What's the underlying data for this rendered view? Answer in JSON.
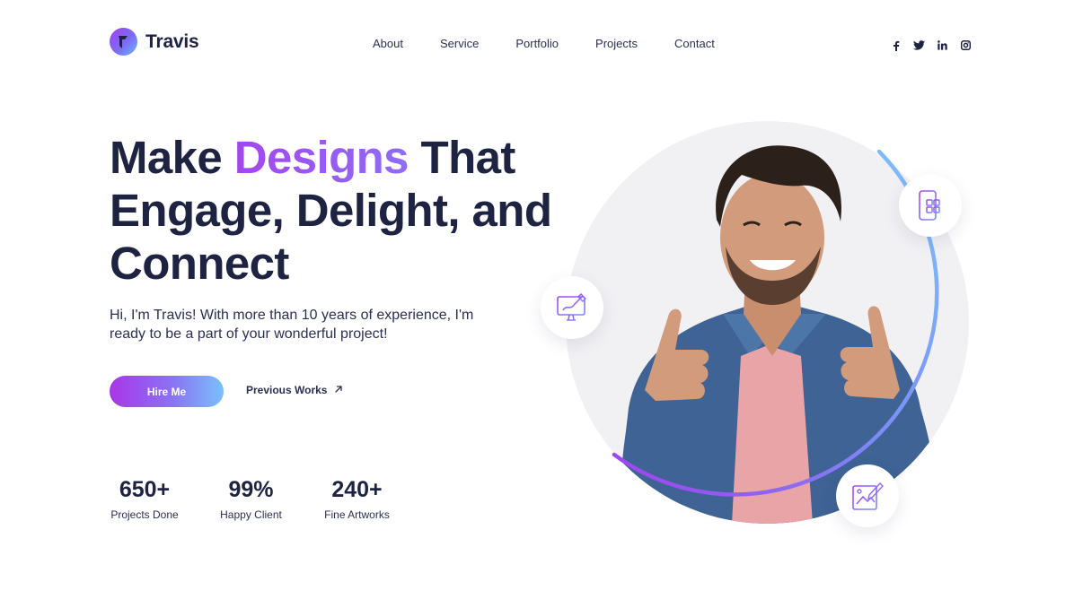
{
  "brand": {
    "name": "Travis",
    "logo_icon": "logo-mark",
    "gradient": [
      "#a23ff0",
      "#6fb6f9"
    ]
  },
  "nav": {
    "items": [
      {
        "label": "About"
      },
      {
        "label": "Service"
      },
      {
        "label": "Portfolio"
      },
      {
        "label": "Projects"
      },
      {
        "label": "Contact"
      }
    ]
  },
  "social": {
    "icons": [
      "facebook-icon",
      "twitter-icon",
      "linkedin-icon",
      "instagram-icon"
    ]
  },
  "hero": {
    "headline": {
      "part1": "Make ",
      "accent": "Designs",
      "part2": " That Engage, Delight, and Connect"
    },
    "intro": "Hi, I'm Travis! With more than 10 years of experience, I'm ready to be a part of your wonderful project!",
    "primary_button": "Hire Me",
    "secondary_link": "Previous Works",
    "secondary_icon": "arrow-up-right-icon"
  },
  "stats": [
    {
      "value": "650+",
      "label": "Projects Done"
    },
    {
      "value": "99%",
      "label": "Happy Client"
    },
    {
      "value": "240+",
      "label": "Fine Artworks"
    }
  ],
  "badges": [
    "mobile-app-icon",
    "web-design-icon",
    "graphic-design-icon"
  ],
  "colors": {
    "text": "#1d2340",
    "accent_purple": "#a346ef",
    "accent_blue": "#79c1fb",
    "photo_bg": "#f1f1f4"
  }
}
